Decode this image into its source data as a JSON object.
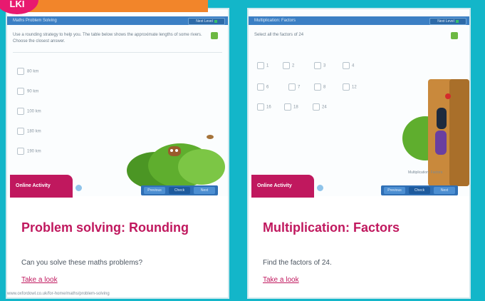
{
  "banner": {
    "badge": "LKI",
    "text": "",
    "badge_color": "#e8196f",
    "banner_color": "#f2852a"
  },
  "cards": [
    {
      "app_bar_title": "Maths Problem Solving",
      "app_bar_button": "Next Level",
      "question": "Use a rounding strategy to help you. The table below shows the approximate lengths of some rivers. Choose the closest answer.",
      "choices": [
        "80 km",
        "90 km",
        "100 km",
        "180 km",
        "190 km"
      ],
      "controls": [
        "Previous",
        "Check",
        "Next"
      ],
      "activity_tag": "Online Activity",
      "title": "Problem solving: Rounding",
      "description": "Can you solve these maths problems?",
      "link": "Take a look",
      "footer": "www.oxfordowl.co.uk/for-home/maths/problem-solving"
    },
    {
      "app_bar_title": "Multiplication: Factors",
      "app_bar_button": "Next Level",
      "question": "Select all the factors of 24",
      "factors": [
        "1",
        "2",
        "3",
        "4",
        "6",
        "7",
        "8",
        "12",
        "16",
        "18",
        "24"
      ],
      "controls": [
        "Previous",
        "Check",
        "Next"
      ],
      "activity_tag": "Online Activity",
      "caption": "Multiplication: Factors",
      "title": "Multiplication: Factors",
      "description": "Find the factors of 24.",
      "link": "Take a look"
    }
  ],
  "colors": {
    "background": "#13b6c9",
    "accent": "#c0185e",
    "app_bar": "#3b7fc4"
  }
}
